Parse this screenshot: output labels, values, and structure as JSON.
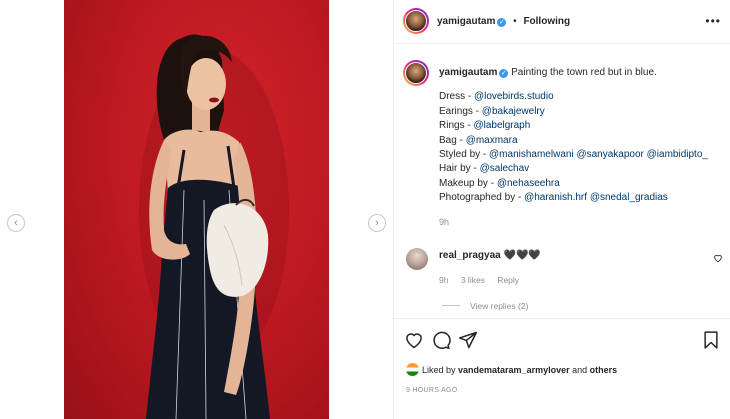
{
  "post": {
    "author": "yamigautam",
    "follow_separator": "•",
    "follow_status": "Following",
    "more_icon": "more-horizontal-icon"
  },
  "caption": {
    "author": "yamigautam",
    "text": "Painting the town red but in blue.",
    "credits": [
      {
        "label": "Dress - ",
        "handles": [
          "@lovebirds.studio"
        ]
      },
      {
        "label": "Earings - ",
        "handles": [
          "@bakajewelry"
        ]
      },
      {
        "label": "Rings - ",
        "handles": [
          "@labelgraph"
        ]
      },
      {
        "label": "Bag - ",
        "handles": [
          "@maxmara"
        ]
      },
      {
        "label": "Styled by - ",
        "handles": [
          "@manishamelwani",
          "@sanyakapoor",
          "@iambidipto_"
        ]
      },
      {
        "label": "Hair by - ",
        "handles": [
          "@salechav"
        ]
      },
      {
        "label": "Makeup by - ",
        "handles": [
          "@nehaseehra"
        ]
      },
      {
        "label": "Photographed by - ",
        "handles": [
          "@haranish.hrf",
          "@snedal_gradias"
        ]
      }
    ],
    "time": "9h"
  },
  "comment": {
    "author": "real_pragyaa",
    "text": "🖤🖤🖤",
    "time": "9h",
    "likes": "3 likes",
    "reply": "Reply",
    "view_replies": "View replies (2)"
  },
  "likes_line": {
    "prefix": "Liked by ",
    "user": "vandemataram_armylover",
    "middle": " and ",
    "others": "others"
  },
  "timestamp": "9 HOURS AGO",
  "colors": {
    "background_red": "#bf1a22",
    "link": "#00376b",
    "verified": "#3897f0",
    "muted": "#8e8e8e"
  }
}
